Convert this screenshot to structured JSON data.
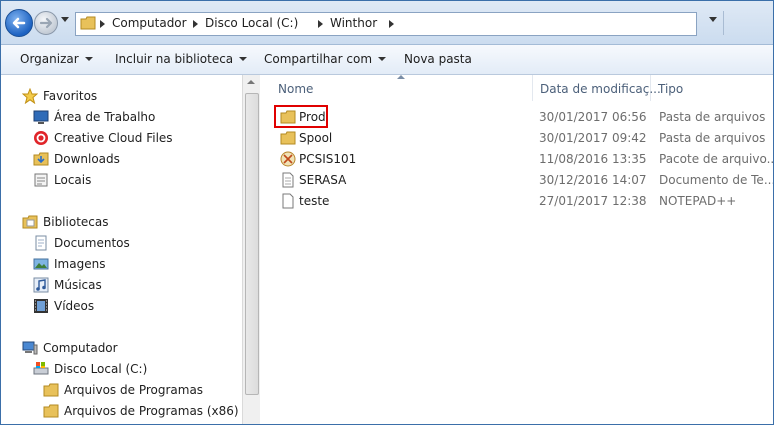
{
  "address": {
    "breadcrumbs": [
      "Computador",
      "Disco Local (C:)",
      "Winthor"
    ]
  },
  "toolbar": {
    "organize": "Organizar",
    "include_library": "Incluir na biblioteca",
    "share": "Compartilhar com",
    "new_folder": "Nova pasta"
  },
  "nav": {
    "favorites": {
      "label": "Favoritos",
      "icon": "star-icon"
    },
    "favorite_items": [
      {
        "label": "Área de Trabalho",
        "icon": "desktop-icon"
      },
      {
        "label": "Creative Cloud Files",
        "icon": "creative-cloud-icon"
      },
      {
        "label": "Downloads",
        "icon": "downloads-folder-icon"
      },
      {
        "label": "Locais",
        "icon": "recent-places-icon"
      }
    ],
    "libraries": {
      "label": "Bibliotecas",
      "icon": "libraries-icon"
    },
    "library_items": [
      {
        "label": "Documentos",
        "icon": "documents-icon"
      },
      {
        "label": "Imagens",
        "icon": "pictures-icon"
      },
      {
        "label": "Músicas",
        "icon": "music-icon"
      },
      {
        "label": "Vídeos",
        "icon": "videos-icon"
      }
    ],
    "computer": {
      "label": "Computador",
      "icon": "computer-icon"
    },
    "computer_items": [
      {
        "label": "Disco Local (C:)",
        "icon": "drive-icon"
      },
      {
        "label": "Arquivos de Programas",
        "icon": "folder-icon"
      },
      {
        "label": "Arquivos de Programas (x86)",
        "icon": "folder-icon"
      }
    ]
  },
  "columns": {
    "name": "Nome",
    "date": "Data de modificaç...",
    "type": "Tipo"
  },
  "files": [
    {
      "name": "Prod",
      "date": "30/01/2017 06:56",
      "type": "Pasta de arquivos",
      "icon": "folder-icon"
    },
    {
      "name": "Spool",
      "date": "30/01/2017 09:42",
      "type": "Pasta de arquivos",
      "icon": "folder-icon"
    },
    {
      "name": "PCSIS101",
      "date": "11/08/2016 13:35",
      "type": "Pacote de arquivo...",
      "icon": "archive-icon"
    },
    {
      "name": "SERASA",
      "date": "30/12/2016 14:07",
      "type": "Documento de Te...",
      "icon": "text-document-icon"
    },
    {
      "name": "teste",
      "date": "27/01/2017 12:38",
      "type": "NOTEPAD++",
      "icon": "notepad-file-icon"
    }
  ],
  "colors": {
    "highlight": "#e00000",
    "accent": "#3b6fa9"
  }
}
